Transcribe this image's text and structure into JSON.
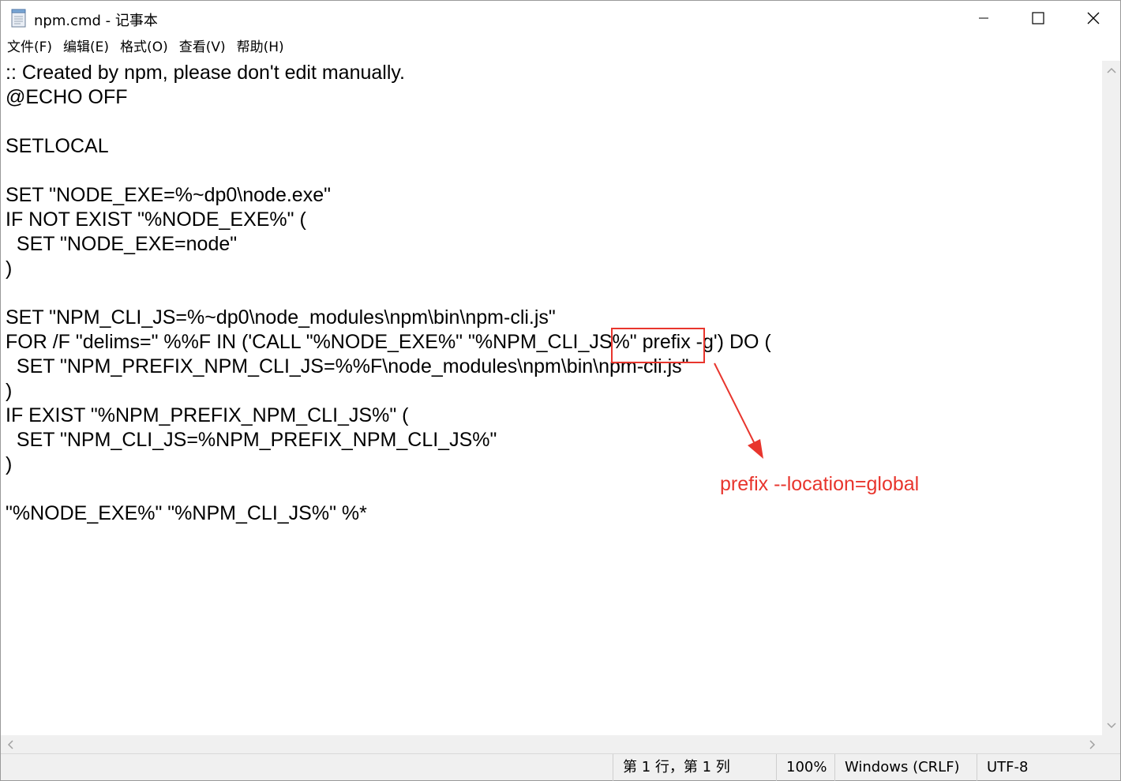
{
  "window": {
    "title": "npm.cmd - 记事本",
    "icon": "notepad-icon"
  },
  "window_controls": {
    "minimize_icon": "minimize-icon",
    "maximize_icon": "maximize-icon",
    "close_icon": "close-icon"
  },
  "menu": [
    {
      "label": "文件(F)"
    },
    {
      "label": "编辑(E)"
    },
    {
      "label": "格式(O)"
    },
    {
      "label": "查看(V)"
    },
    {
      "label": "帮助(H)"
    }
  ],
  "editor": {
    "lines": [
      ":: Created by npm, please don't edit manually.",
      "@ECHO OFF",
      "",
      "SETLOCAL",
      "",
      "SET \"NODE_EXE=%~dp0\\node.exe\"",
      "IF NOT EXIST \"%NODE_EXE%\" (",
      "  SET \"NODE_EXE=node\"",
      ")",
      "",
      "SET \"NPM_CLI_JS=%~dp0\\node_modules\\npm\\bin\\npm-cli.js\"",
      "FOR /F \"delims=\" %%F IN ('CALL \"%NODE_EXE%\" \"%NPM_CLI_JS%\" prefix -g') DO (",
      "  SET \"NPM_PREFIX_NPM_CLI_JS=%%F\\node_modules\\npm\\bin\\npm-cli.js\"",
      ")",
      "IF EXIST \"%NPM_PREFIX_NPM_CLI_JS%\" (",
      "  SET \"NPM_CLI_JS=%NPM_PREFIX_NPM_CLI_JS%\"",
      ")",
      "",
      "\"%NODE_EXE%\" \"%NPM_CLI_JS%\" %*"
    ]
  },
  "annotation": {
    "text": "prefix --location=global",
    "color": "#e8352d"
  },
  "statusbar": {
    "position": "第 1 行，第 1 列",
    "zoom": "100%",
    "line_ending": "Windows (CRLF)",
    "encoding": "UTF-8"
  }
}
